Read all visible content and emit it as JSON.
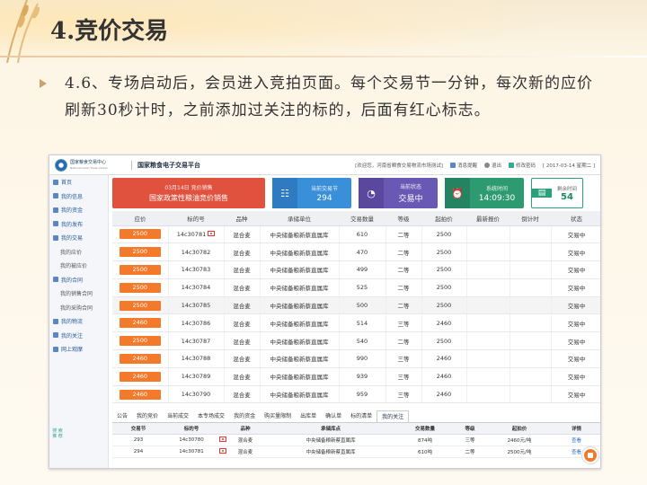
{
  "slide": {
    "title": "4.竞价交易",
    "bullet": "4.6、专场启动后，会员进入竞拍页面。每个交易节一分钟，每次新的应价刷新30秒计时，之前添加过关注的标的，后面有红心标志。"
  },
  "app": {
    "logo_name": "国家粮食交易中心",
    "logo_sub": "National Grain Trade Center",
    "platform": "国家粮食电子交易平台",
    "welcome": "[欢迎您，河南省粮食交易物流市场测试]",
    "messages": "消息提醒",
    "logout": "退出",
    "change_pwd": "修改密码",
    "date": "[ 2017-03-14 星期二 ]"
  },
  "sidebar": {
    "items": [
      {
        "label": "首页",
        "sub": false
      },
      {
        "label": "我的信息",
        "sub": false
      },
      {
        "label": "我的资金",
        "sub": false
      },
      {
        "label": "我的发布",
        "sub": false
      },
      {
        "label": "我的交易",
        "sub": false
      },
      {
        "label": "我的应价",
        "sub": true
      },
      {
        "label": "我的被应价",
        "sub": true
      },
      {
        "label": "我的合同",
        "sub": false
      },
      {
        "label": "我的销售合同",
        "sub": true
      },
      {
        "label": "我的采购合同",
        "sub": true
      },
      {
        "label": "我的物流",
        "sub": false
      },
      {
        "label": "我的关注",
        "sub": false
      },
      {
        "label": "网上观摩",
        "sub": false
      }
    ],
    "bottom": "搜 索 推 荐"
  },
  "cards": {
    "session_line1": "03月14日 竞价销售",
    "session_line2": "国家政策性粮油竞价销售",
    "current_label": "当前交易节",
    "current_value": "294",
    "status_label": "当前状态",
    "status_value": "交易中",
    "time_label": "系统时间",
    "time_value": "14:09:30",
    "remain_label": "剩余时间",
    "remain_value": "54"
  },
  "grid": {
    "headers": [
      "应价",
      "标的号",
      "品种",
      "承储单位",
      "交易数量",
      "等级",
      "起拍价",
      "最新报价",
      "倒计时",
      "状态"
    ],
    "rows": [
      {
        "price": "2500",
        "lot": "14c30781",
        "fav": true,
        "kind": "混合麦",
        "unit": "中央储备粮新蔡直属库",
        "qty": "610",
        "grade": "二等",
        "start": "2500",
        "latest": "",
        "countdown": "",
        "status": "交易中"
      },
      {
        "price": "2500",
        "lot": "14c30782",
        "fav": false,
        "kind": "混合麦",
        "unit": "中央储备粮新蔡直属库",
        "qty": "470",
        "grade": "二等",
        "start": "2500",
        "latest": "",
        "countdown": "",
        "status": "交易中"
      },
      {
        "price": "2500",
        "lot": "14c30783",
        "fav": false,
        "kind": "混合麦",
        "unit": "中央储备粮新蔡直属库",
        "qty": "499",
        "grade": "二等",
        "start": "2500",
        "latest": "",
        "countdown": "",
        "status": "交易中"
      },
      {
        "price": "2500",
        "lot": "14c30784",
        "fav": false,
        "kind": "混合麦",
        "unit": "中央储备粮新蔡直属库",
        "qty": "525",
        "grade": "二等",
        "start": "2500",
        "latest": "",
        "countdown": "",
        "status": "交易中"
      },
      {
        "price": "2500",
        "lot": "14c30785",
        "fav": false,
        "kind": "混合麦",
        "unit": "中央储备粮新蔡直属库",
        "qty": "500",
        "grade": "二等",
        "start": "2500",
        "latest": "",
        "countdown": "",
        "status": "交易中"
      },
      {
        "price": "2460",
        "lot": "14c30786",
        "fav": false,
        "kind": "混合麦",
        "unit": "中央储备粮新蔡直属库",
        "qty": "514",
        "grade": "三等",
        "start": "2460",
        "latest": "",
        "countdown": "",
        "status": "交易中"
      },
      {
        "price": "2500",
        "lot": "14c30787",
        "fav": false,
        "kind": "混合麦",
        "unit": "中央储备粮新蔡直属库",
        "qty": "540",
        "grade": "二等",
        "start": "2500",
        "latest": "",
        "countdown": "",
        "status": "交易中"
      },
      {
        "price": "2460",
        "lot": "14c30788",
        "fav": false,
        "kind": "混合麦",
        "unit": "中央储备粮新蔡直属库",
        "qty": "990",
        "grade": "三等",
        "start": "2460",
        "latest": "",
        "countdown": "",
        "status": "交易中"
      },
      {
        "price": "2460",
        "lot": "14c30789",
        "fav": false,
        "kind": "混合麦",
        "unit": "中央储备粮新蔡直属库",
        "qty": "939",
        "grade": "三等",
        "start": "2460",
        "latest": "",
        "countdown": "",
        "status": "交易中"
      },
      {
        "price": "2460",
        "lot": "14c30790",
        "fav": false,
        "kind": "混合麦",
        "unit": "中央储备粮新蔡直属库",
        "qty": "959",
        "grade": "三等",
        "start": "2460",
        "latest": "",
        "countdown": "",
        "status": "交易中"
      }
    ]
  },
  "tabs": [
    "公告",
    "我的竞价",
    "当前成交",
    "本专场成交",
    "我的资金",
    "购买量限制",
    "出库单",
    "确认单",
    "标的清单",
    "我的关注"
  ],
  "active_tab": 9,
  "follow": {
    "headers": [
      "交易节",
      "标的号",
      "品种",
      "承储库点",
      "交易数量",
      "等级",
      "起拍价",
      "详情"
    ],
    "rows": [
      {
        "session": "293",
        "lot": "14c30780",
        "fav": true,
        "kind": "混合麦",
        "store": "中央储备粮新蔡直属库",
        "qty": "874吨",
        "grade": "三等",
        "start": "2460元/吨",
        "detail": "查看"
      },
      {
        "session": "294",
        "lot": "14c30781",
        "fav": true,
        "kind": "混合麦",
        "store": "中央储备粮新蔡直属库",
        "qty": "610吨",
        "grade": "二等",
        "start": "2500元/吨",
        "detail": "查看"
      }
    ]
  },
  "colors": {
    "accent_orange": "#f27a2a",
    "card_red": "#e0523e",
    "card_blue": "#3a8fd9",
    "card_purple": "#6a58b5",
    "card_green": "#2e9a72"
  }
}
